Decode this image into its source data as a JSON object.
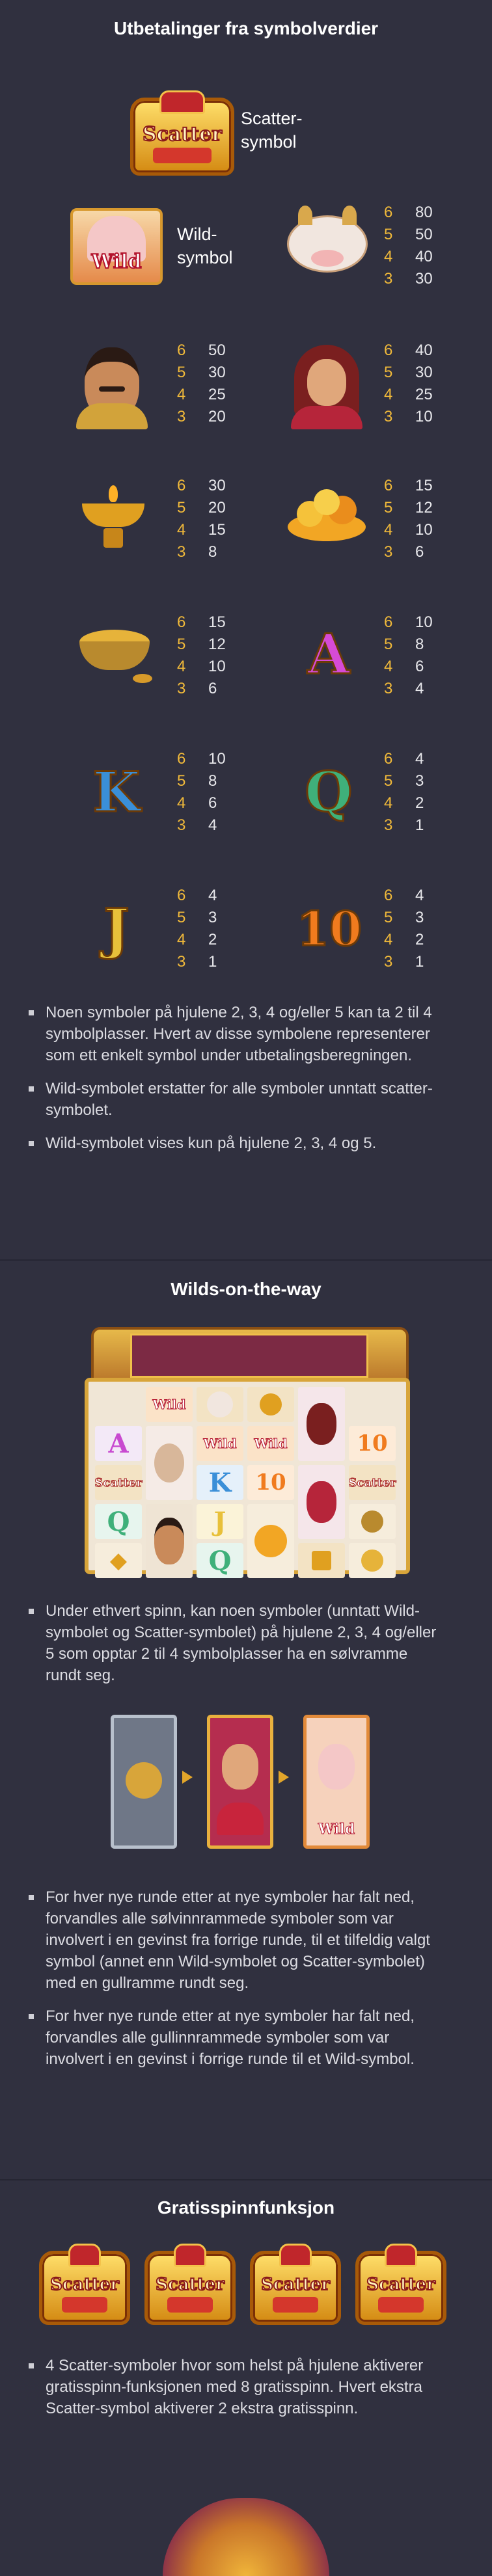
{
  "paytable_section": {
    "title": "Utbetalinger fra symbolverdier",
    "scatter_label": "Scatter-\nsymbol",
    "scatter_label_l1": "Scatter-",
    "scatter_label_l2": "symbol",
    "scatter_badge_text": "Scatter",
    "wild_label_l1": "Wild-",
    "wild_label_l2": "symbol",
    "wild_badge_text": "Wild",
    "symbols": [
      {
        "id": "cow",
        "payouts": [
          {
            "count": "6",
            "value": "80"
          },
          {
            "count": "5",
            "value": "50"
          },
          {
            "count": "4",
            "value": "40"
          },
          {
            "count": "3",
            "value": "30"
          }
        ]
      },
      {
        "id": "man",
        "payouts": [
          {
            "count": "6",
            "value": "50"
          },
          {
            "count": "5",
            "value": "30"
          },
          {
            "count": "4",
            "value": "25"
          },
          {
            "count": "3",
            "value": "20"
          }
        ]
      },
      {
        "id": "woman",
        "payouts": [
          {
            "count": "6",
            "value": "40"
          },
          {
            "count": "5",
            "value": "30"
          },
          {
            "count": "4",
            "value": "25"
          },
          {
            "count": "3",
            "value": "10"
          }
        ]
      },
      {
        "id": "lamp",
        "payouts": [
          {
            "count": "6",
            "value": "30"
          },
          {
            "count": "5",
            "value": "20"
          },
          {
            "count": "4",
            "value": "15"
          },
          {
            "count": "3",
            "value": "8"
          }
        ]
      },
      {
        "id": "sweets",
        "payouts": [
          {
            "count": "6",
            "value": "15"
          },
          {
            "count": "5",
            "value": "12"
          },
          {
            "count": "4",
            "value": "10"
          },
          {
            "count": "3",
            "value": "6"
          }
        ]
      },
      {
        "id": "spice",
        "payouts": [
          {
            "count": "6",
            "value": "15"
          },
          {
            "count": "5",
            "value": "12"
          },
          {
            "count": "4",
            "value": "10"
          },
          {
            "count": "3",
            "value": "6"
          }
        ]
      },
      {
        "id": "A",
        "payouts": [
          {
            "count": "6",
            "value": "10"
          },
          {
            "count": "5",
            "value": "8"
          },
          {
            "count": "4",
            "value": "6"
          },
          {
            "count": "3",
            "value": "4"
          }
        ]
      },
      {
        "id": "K",
        "payouts": [
          {
            "count": "6",
            "value": "10"
          },
          {
            "count": "5",
            "value": "8"
          },
          {
            "count": "4",
            "value": "6"
          },
          {
            "count": "3",
            "value": "4"
          }
        ]
      },
      {
        "id": "Q",
        "payouts": [
          {
            "count": "6",
            "value": "4"
          },
          {
            "count": "5",
            "value": "3"
          },
          {
            "count": "4",
            "value": "2"
          },
          {
            "count": "3",
            "value": "1"
          }
        ]
      },
      {
        "id": "J",
        "payouts": [
          {
            "count": "6",
            "value": "4"
          },
          {
            "count": "5",
            "value": "3"
          },
          {
            "count": "4",
            "value": "2"
          },
          {
            "count": "3",
            "value": "1"
          }
        ]
      },
      {
        "id": "10",
        "payouts": [
          {
            "count": "6",
            "value": "4"
          },
          {
            "count": "5",
            "value": "3"
          },
          {
            "count": "4",
            "value": "2"
          },
          {
            "count": "3",
            "value": "1"
          }
        ]
      }
    ],
    "letters": {
      "A": "A",
      "K": "K",
      "Q": "Q",
      "J": "J",
      "ten": "10"
    },
    "bullets": [
      "Noen symboler på hjulene 2, 3, 4 og/eller 5 kan ta 2 til 4 symbolplasser. Hvert av disse symbolene representerer som ett enkelt symbol under utbetalingsberegningen.",
      "Wild-symbolet erstatter for alle symboler unntatt scatter-symbolet.",
      "Wild-symbolet vises kun på hjulene 2, 3, 4 og 5."
    ]
  },
  "wilds_section": {
    "title": "Wilds-on-the-way",
    "bullet1": "Under ethvert spinn, kan noen symboler (unntatt Wild-symbolet og Scatter-symbolet) på hjulene 2, 3, 4 og/eller 5 som opptar 2 til 4 symbolplasser ha en sølvramme rundt seg.",
    "bullets2": [
      "For hver nye runde etter at nye symboler har falt ned, forvandles alle sølvinnrammede symboler som var involvert i en gevinst fra forrige runde, til et tilfeldig valgt symbol (annet enn Wild-symbolet og Scatter-symbolet) med en gullramme rundt seg.",
      "For hver nye runde etter at nye symboler har falt ned, forvandles alle gullinnrammede symboler som var involvert i en gevinst i forrige runde til et Wild-symbol."
    ],
    "grid_letters": {
      "A": "A",
      "ten": "10",
      "K": "K",
      "Q": "Q",
      "J": "J"
    },
    "wild_text": "Wild",
    "scatter_text": "Scatter"
  },
  "free_spins_section": {
    "title": "Gratisspinnfunksjon",
    "scatter_text": "Scatter",
    "bullet": "4 Scatter-symboler hvor som helst på hjulene aktiverer gratisspinn-funksjonen med 8 gratisspinn. Hvert ekstra Scatter-symbol aktiverer 2 ekstra gratisspinn."
  },
  "colors": {
    "background": "#30303f",
    "accent_gold": "#f0b93a",
    "divider": "#262633"
  }
}
